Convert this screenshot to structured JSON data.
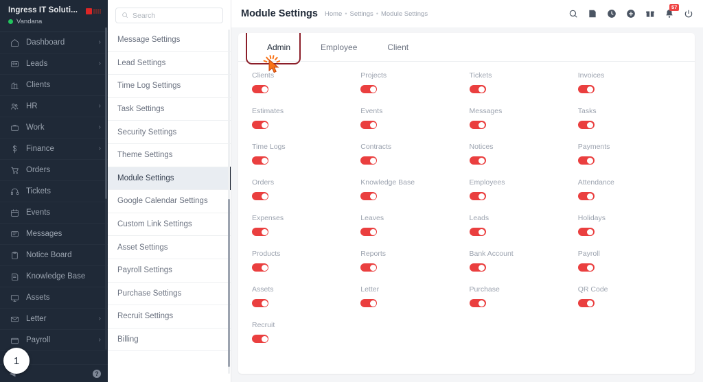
{
  "sidebar": {
    "company": "Ingress IT Soluti...",
    "user": "Vandana",
    "status_color": "#22c55e",
    "logo_icon": "brand-logo-icon",
    "items": [
      {
        "label": "Dashboard",
        "icon": "home-icon",
        "caret": "›"
      },
      {
        "label": "Leads",
        "icon": "lead-card-icon",
        "caret": "›"
      },
      {
        "label": "Clients",
        "icon": "building-icon",
        "caret": ""
      },
      {
        "label": "HR",
        "icon": "people-icon",
        "caret": "›"
      },
      {
        "label": "Work",
        "icon": "briefcase-icon",
        "caret": "›"
      },
      {
        "label": "Finance",
        "icon": "dollar-icon",
        "caret": "›"
      },
      {
        "label": "Orders",
        "icon": "cart-icon",
        "caret": ""
      },
      {
        "label": "Tickets",
        "icon": "headset-icon",
        "caret": ""
      },
      {
        "label": "Events",
        "icon": "calendar-icon",
        "caret": ""
      },
      {
        "label": "Messages",
        "icon": "chat-icon",
        "caret": ""
      },
      {
        "label": "Notice Board",
        "icon": "clipboard-icon",
        "caret": ""
      },
      {
        "label": "Knowledge Base",
        "icon": "book-icon",
        "caret": ""
      },
      {
        "label": "Assets",
        "icon": "monitor-icon",
        "caret": ""
      },
      {
        "label": "Letter",
        "icon": "envelope-icon",
        "caret": "›"
      },
      {
        "label": "Payroll",
        "icon": "wallet-icon",
        "caret": "›"
      }
    ],
    "help_label": "?",
    "step_badge": "1"
  },
  "header": {
    "title": "Module Settings",
    "breadcrumb": [
      "Home",
      "Settings",
      "Module Settings"
    ],
    "breadcrumb_separator": "•",
    "icons": [
      {
        "name": "search-icon"
      },
      {
        "name": "note-icon"
      },
      {
        "name": "clock-icon"
      },
      {
        "name": "plus-circle-icon"
      },
      {
        "name": "gift-icon"
      },
      {
        "name": "bell-icon",
        "badge": "57"
      },
      {
        "name": "power-icon"
      }
    ]
  },
  "settings_menu": {
    "search": {
      "placeholder": "Search",
      "value": "",
      "icon": "search-icon"
    },
    "items": [
      {
        "label": "Message Settings",
        "active": false
      },
      {
        "label": "Lead Settings",
        "active": false
      },
      {
        "label": "Time Log Settings",
        "active": false
      },
      {
        "label": "Task Settings",
        "active": false
      },
      {
        "label": "Security Settings",
        "active": false
      },
      {
        "label": "Theme Settings",
        "active": false
      },
      {
        "label": "Module Settings",
        "active": true
      },
      {
        "label": "Google Calendar Settings",
        "active": false
      },
      {
        "label": "Custom Link Settings",
        "active": false
      },
      {
        "label": "Asset Settings",
        "active": false
      },
      {
        "label": "Payroll Settings",
        "active": false
      },
      {
        "label": "Purchase Settings",
        "active": false
      },
      {
        "label": "Recruit Settings",
        "active": false
      },
      {
        "label": "Billing",
        "active": false
      }
    ]
  },
  "main": {
    "tabs": [
      {
        "label": "Admin",
        "active": true,
        "highlighted": true
      },
      {
        "label": "Employee",
        "active": false,
        "highlighted": false
      },
      {
        "label": "Client",
        "active": false,
        "highlighted": false
      }
    ],
    "highlight_color": "#8b1e29",
    "cursor_color": "#f97316",
    "toggle_on_color": "#ea3f3f",
    "modules": [
      {
        "label": "Clients",
        "enabled": true
      },
      {
        "label": "Projects",
        "enabled": true
      },
      {
        "label": "Tickets",
        "enabled": true
      },
      {
        "label": "Invoices",
        "enabled": true
      },
      {
        "label": "Estimates",
        "enabled": true
      },
      {
        "label": "Events",
        "enabled": true
      },
      {
        "label": "Messages",
        "enabled": true
      },
      {
        "label": "Tasks",
        "enabled": true
      },
      {
        "label": "Time Logs",
        "enabled": true
      },
      {
        "label": "Contracts",
        "enabled": true
      },
      {
        "label": "Notices",
        "enabled": true
      },
      {
        "label": "Payments",
        "enabled": true
      },
      {
        "label": "Orders",
        "enabled": true
      },
      {
        "label": "Knowledge Base",
        "enabled": true
      },
      {
        "label": "Employees",
        "enabled": true
      },
      {
        "label": "Attendance",
        "enabled": true
      },
      {
        "label": "Expenses",
        "enabled": true
      },
      {
        "label": "Leaves",
        "enabled": true
      },
      {
        "label": "Leads",
        "enabled": true
      },
      {
        "label": "Holidays",
        "enabled": true
      },
      {
        "label": "Products",
        "enabled": true
      },
      {
        "label": "Reports",
        "enabled": true
      },
      {
        "label": "Bank Account",
        "enabled": true
      },
      {
        "label": "Payroll",
        "enabled": true
      },
      {
        "label": "Assets",
        "enabled": true
      },
      {
        "label": "Letter",
        "enabled": true
      },
      {
        "label": "Purchase",
        "enabled": true
      },
      {
        "label": "QR Code",
        "enabled": true
      },
      {
        "label": "Recruit",
        "enabled": true
      }
    ]
  }
}
